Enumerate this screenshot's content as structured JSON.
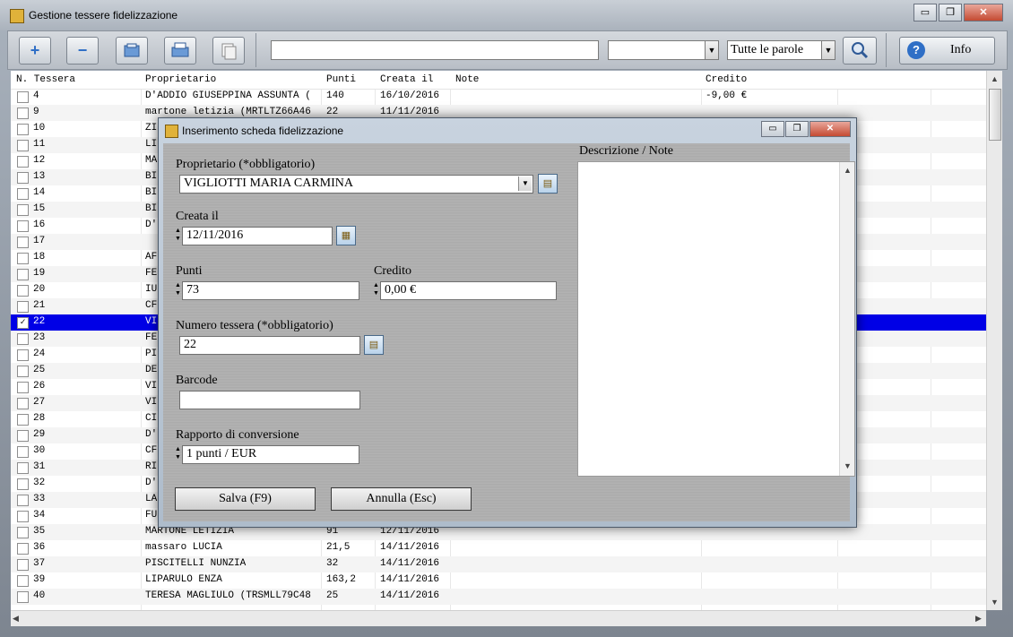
{
  "window": {
    "title": "Gestione tessere fidelizzazione",
    "controls": [
      "▭",
      "❐",
      "✕"
    ]
  },
  "toolbar": {
    "add_glyph": "+",
    "remove_glyph": "−",
    "search_value": "",
    "field_select_value": "",
    "mode_select_value": "Tutte le parole",
    "info_label": "Info"
  },
  "table": {
    "columns": [
      "N. Tessera",
      "Proprietario",
      "Punti",
      "Creata il",
      "Note",
      "Credito"
    ],
    "rows": [
      {
        "n": "4",
        "owner": "D'ADDIO GIUSEPPINA ASSUNTA (",
        "punti": "140",
        "creata": "16/10/2016",
        "credito": "-9,00 €",
        "checked": false
      },
      {
        "n": "9",
        "owner": "martone letizia (MRTLTZ66A46",
        "punti": "22",
        "creata": "11/11/2016",
        "credito": "",
        "checked": false
      },
      {
        "n": "10",
        "owner": "ZI",
        "punti": "",
        "creata": "",
        "credito": "",
        "checked": false
      },
      {
        "n": "11",
        "owner": "LI",
        "punti": "",
        "creata": "",
        "credito": "",
        "checked": false
      },
      {
        "n": "12",
        "owner": "MA",
        "punti": "",
        "creata": "",
        "credito": "",
        "checked": false
      },
      {
        "n": "13",
        "owner": "BI",
        "punti": "",
        "creata": "",
        "credito": "",
        "checked": false
      },
      {
        "n": "14",
        "owner": "BI",
        "punti": "",
        "creata": "",
        "credito": "",
        "checked": false
      },
      {
        "n": "15",
        "owner": "BI",
        "punti": "",
        "creata": "",
        "credito": "",
        "checked": false
      },
      {
        "n": "16",
        "owner": "D'",
        "punti": "",
        "creata": "",
        "credito": "",
        "checked": false
      },
      {
        "n": "17",
        "owner": "",
        "punti": "",
        "creata": "",
        "credito": "",
        "checked": false
      },
      {
        "n": "18",
        "owner": "AF",
        "punti": "",
        "creata": "",
        "credito": "",
        "checked": false
      },
      {
        "n": "19",
        "owner": "FE",
        "punti": "",
        "creata": "",
        "credito": "",
        "checked": false
      },
      {
        "n": "20",
        "owner": "IU",
        "punti": "",
        "creata": "",
        "credito": "",
        "checked": false
      },
      {
        "n": "21",
        "owner": "CF",
        "punti": "",
        "creata": "",
        "credito": "",
        "checked": false
      },
      {
        "n": "22",
        "owner": "VI",
        "punti": "",
        "creata": "",
        "credito": "",
        "checked": true
      },
      {
        "n": "23",
        "owner": "FE",
        "punti": "",
        "creata": "",
        "credito": "",
        "checked": false
      },
      {
        "n": "24",
        "owner": "PI",
        "punti": "",
        "creata": "",
        "credito": "",
        "checked": false
      },
      {
        "n": "25",
        "owner": "DE",
        "punti": "",
        "creata": "",
        "credito": "",
        "checked": false
      },
      {
        "n": "26",
        "owner": "VI",
        "punti": "",
        "creata": "",
        "credito": "",
        "checked": false
      },
      {
        "n": "27",
        "owner": "VI",
        "punti": "",
        "creata": "",
        "credito": "",
        "checked": false
      },
      {
        "n": "28",
        "owner": "CI",
        "punti": "",
        "creata": "",
        "credito": "",
        "checked": false
      },
      {
        "n": "29",
        "owner": "D'",
        "punti": "",
        "creata": "",
        "credito": "",
        "checked": false
      },
      {
        "n": "30",
        "owner": "CF",
        "punti": "",
        "creata": "",
        "credito": "",
        "checked": false
      },
      {
        "n": "31",
        "owner": "RI",
        "punti": "",
        "creata": "",
        "credito": "",
        "checked": false
      },
      {
        "n": "32",
        "owner": "D'",
        "punti": "",
        "creata": "",
        "credito": "",
        "checked": false
      },
      {
        "n": "33",
        "owner": "LA",
        "punti": "",
        "creata": "",
        "credito": "",
        "checked": false
      },
      {
        "n": "34",
        "owner": "FU",
        "punti": "",
        "creata": "",
        "credito": "",
        "checked": false
      },
      {
        "n": "35",
        "owner": "MARTONE LETIZIA",
        "punti": "91",
        "creata": "12/11/2016",
        "credito": "",
        "checked": false
      },
      {
        "n": "36",
        "owner": "massaro LUCIA",
        "punti": "21,5",
        "creata": "14/11/2016",
        "credito": "",
        "checked": false
      },
      {
        "n": "37",
        "owner": "PISCITELLI NUNZIA",
        "punti": "32",
        "creata": "14/11/2016",
        "credito": "",
        "checked": false
      },
      {
        "n": "39",
        "owner": "LIPARULO ENZA",
        "punti": "163,2",
        "creata": "14/11/2016",
        "credito": "",
        "checked": false
      },
      {
        "n": "40",
        "owner": "TERESA MAGLIULO (TRSMLL79C48",
        "punti": "25",
        "creata": "14/11/2016",
        "credito": "",
        "checked": false
      }
    ]
  },
  "dialog": {
    "title": "Inserimento scheda fidelizzazione",
    "owner_label": "Proprietario (*obbligatorio)",
    "owner_value": "VIGLIOTTI MARIA CARMINA",
    "created_label": "Creata il",
    "created_value": "12/11/2016",
    "points_label": "Punti",
    "points_value": "73",
    "credit_label": "Credito",
    "credit_value": "0,00 €",
    "card_label": "Numero tessera (*obbligatorio)",
    "card_value": "22",
    "barcode_label": "Barcode",
    "barcode_value": "",
    "ratio_label": "Rapporto di conversione",
    "ratio_value": "1 punti / EUR",
    "notes_label": "Descrizione / Note",
    "save_label": "Salva (F9)",
    "cancel_label": "Annulla (Esc)"
  }
}
